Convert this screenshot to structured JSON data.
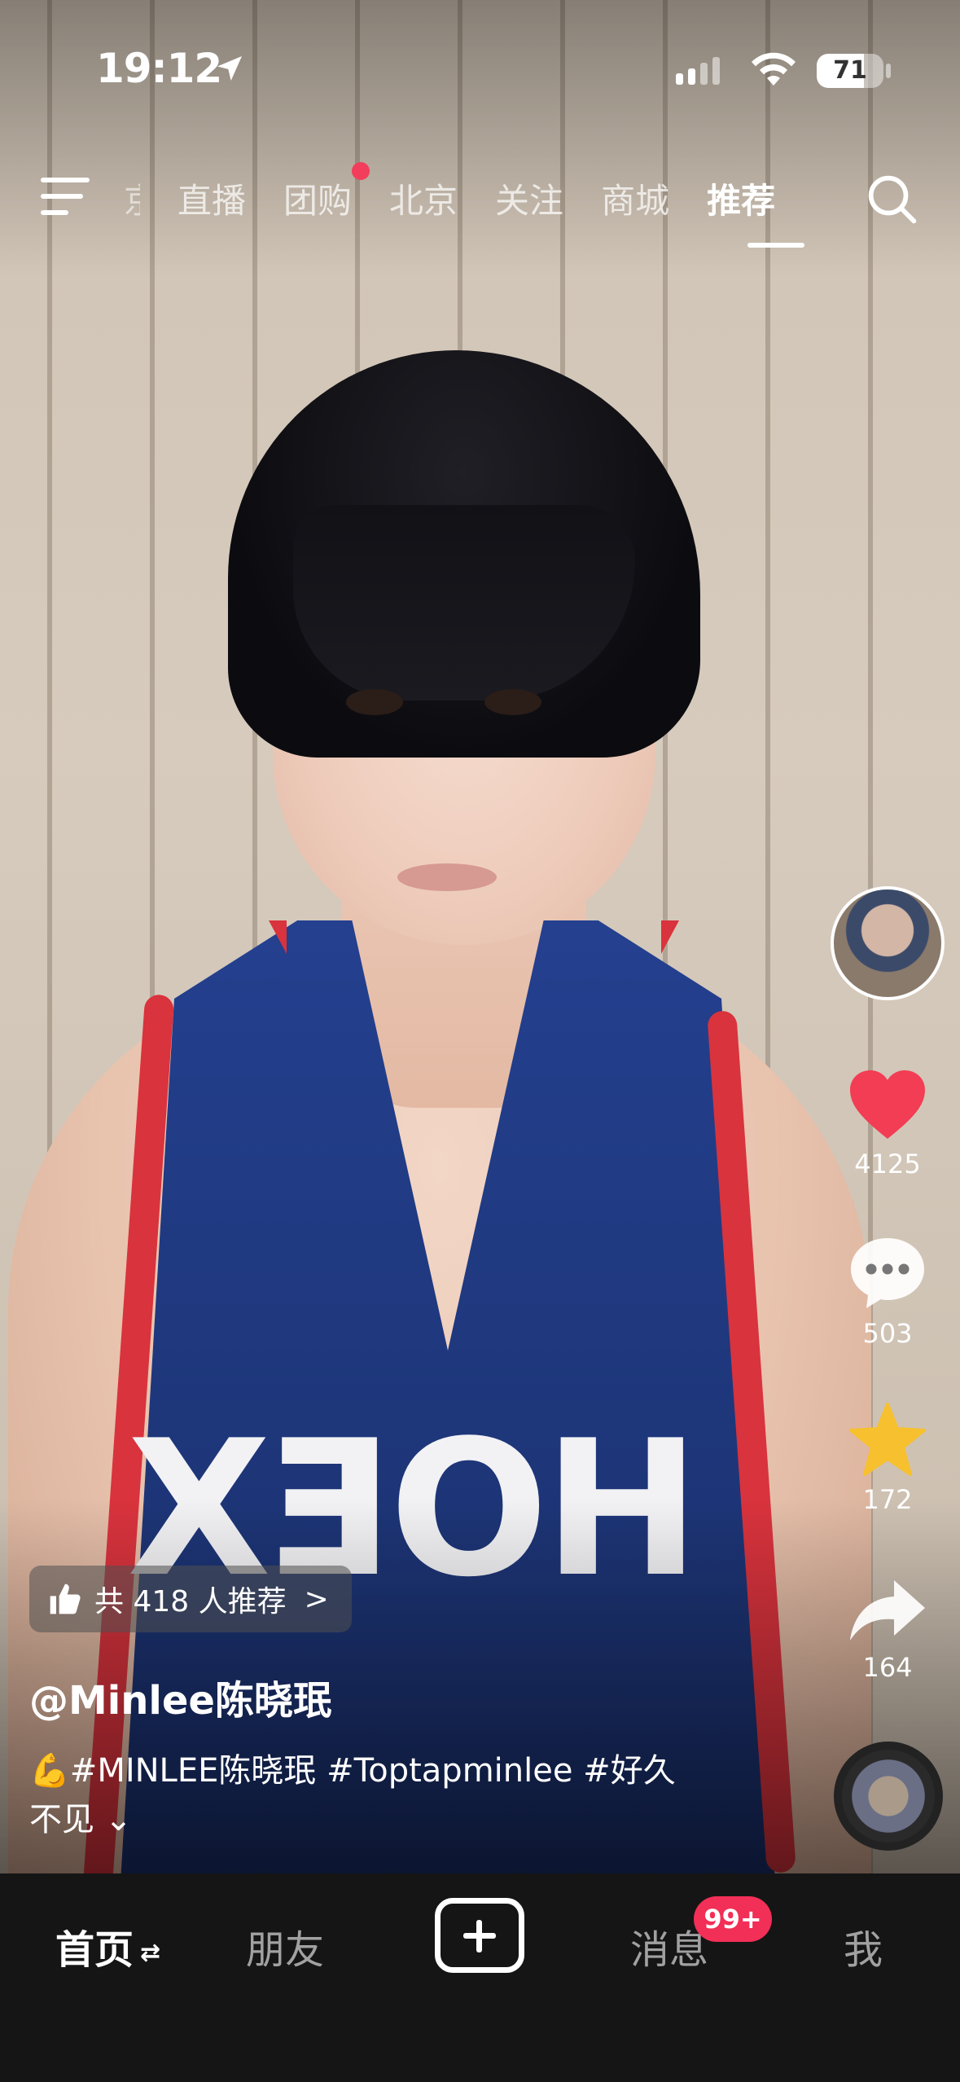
{
  "status_bar": {
    "time": "19:12",
    "battery": "71",
    "battery_level": 0.71
  },
  "top_nav": {
    "tabs": [
      {
        "label": "京",
        "state": "partial"
      },
      {
        "label": "直播"
      },
      {
        "label": "团购",
        "has_dot": true
      },
      {
        "label": "北京"
      },
      {
        "label": "关注"
      },
      {
        "label": "商城"
      },
      {
        "label": "推荐",
        "active": true
      }
    ],
    "icons": {
      "menu": "menu-icon",
      "search": "search-icon"
    }
  },
  "video": {
    "jersey_text": "HOEX",
    "recommend": {
      "text": "共 418 人推荐",
      "chevron": ">"
    },
    "author": "@Minlee陈晓珉",
    "caption": "💪#MINLEE陈晓珉 #Toptapminlee #好久",
    "caption_more": "不见 ⌄"
  },
  "actions": {
    "like_count": "4125",
    "comment_count": "503",
    "favorite_count": "172",
    "share_count": "164",
    "colors": {
      "like": "#f23d54",
      "favorite": "#f7c02e"
    }
  },
  "bottom_nav": {
    "home": "首页",
    "home_switch": "⇄",
    "friends": "朋友",
    "messages": "消息",
    "messages_badge": "99+",
    "me": "我"
  }
}
